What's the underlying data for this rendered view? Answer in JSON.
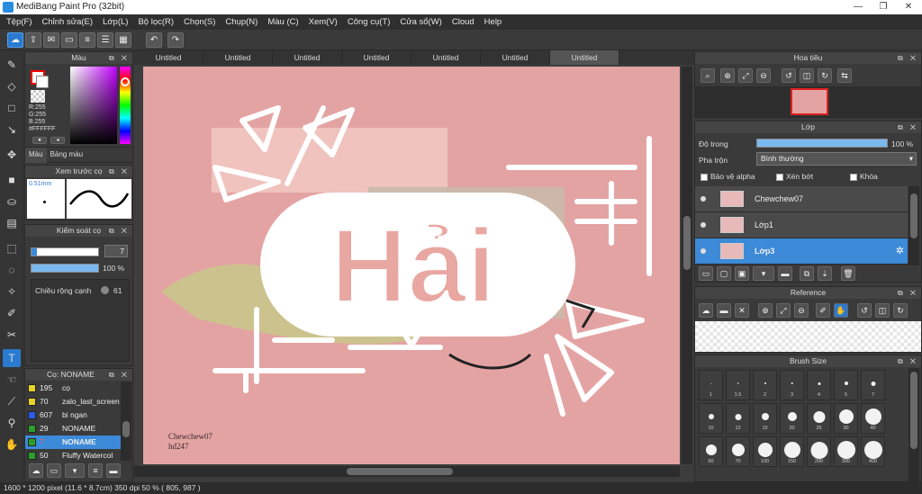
{
  "window": {
    "title": "MediBang Paint Pro (32bit)",
    "min": "—",
    "max": "❐",
    "close": "✕"
  },
  "menu": [
    "Tệp(F)",
    "Chỉnh sửa(E)",
    "Lớp(L)",
    "Bộ lọc(R)",
    "Chọn(S)",
    "Chụp(N)",
    "Màu (C)",
    "Xem(V)",
    "Công cụ(T)",
    "Cửa sổ(W)",
    "Cloud",
    "Help"
  ],
  "doc_tabs": [
    "Untitled",
    "Untitled",
    "Untitled",
    "Untitled",
    "Untitled",
    "Untitled",
    "Untitled"
  ],
  "color_panel": {
    "title": "Màu",
    "r": "R:255",
    "g": "G:255",
    "b": "B:255",
    "hex": "#FFFFFF",
    "tab_color": "Màu",
    "tab_palette": "Bảng màu",
    "fg_color": "#ff0000"
  },
  "brush_preview": {
    "title": "Xem trước cọ",
    "size": "0.51mm"
  },
  "brush_control": {
    "title": "Kiểm soát cọ",
    "size_value": "7",
    "opacity_value": "100 %",
    "width_label": "Chiều rộng cạnh",
    "width_value": "61"
  },
  "brush_list": {
    "title": "Cọ: NONAME",
    "items": [
      {
        "num": "195",
        "name": "cọ",
        "color": "#e6d22a"
      },
      {
        "num": "70",
        "name": "zalo_last_screen",
        "color": "#e6d22a"
      },
      {
        "num": "607",
        "name": "bi ngan",
        "color": "#2a5ae6"
      },
      {
        "num": "29",
        "name": "NONAME",
        "color": "#2aa02a"
      },
      {
        "num": "7",
        "name": "NONAME",
        "color": "#2aa02a"
      },
      {
        "num": "50",
        "name": "Fluffy Watercol",
        "color": "#2aa02a"
      }
    ]
  },
  "artboard": {
    "main_text": "Hải",
    "signature_line1": "Chewchew07",
    "signature_line2": "hd247"
  },
  "navigator": {
    "title": "Hoa tiêu"
  },
  "layers_panel": {
    "title": "Lớp",
    "opacity_label": "Độ trong",
    "opacity_value": "100 %",
    "blend_label": "Pha trộn",
    "blend_value": "Bình thường",
    "protect_alpha": "Bảo vệ alpha",
    "clipping": "Xén bớt",
    "lock": "Khóa",
    "layers": [
      {
        "name": "Chewchew07",
        "selected": false
      },
      {
        "name": "Lớp1",
        "selected": false
      },
      {
        "name": "Lớp3",
        "selected": true
      }
    ]
  },
  "reference_panel": {
    "title": "Reference"
  },
  "brush_size_panel": {
    "title": "Brush Size",
    "sizes": [
      "1",
      "1.5",
      "2",
      "3",
      "4",
      "5",
      "7",
      "10",
      "12",
      "15",
      "20",
      "25",
      "30",
      "40",
      "50",
      "70",
      "100",
      "150",
      "200",
      "300",
      "400"
    ]
  },
  "status": {
    "text": "1600 * 1200 pixel  (11.6 * 8.7cm)  350 dpi  50 %  ( 805, 987 )"
  }
}
